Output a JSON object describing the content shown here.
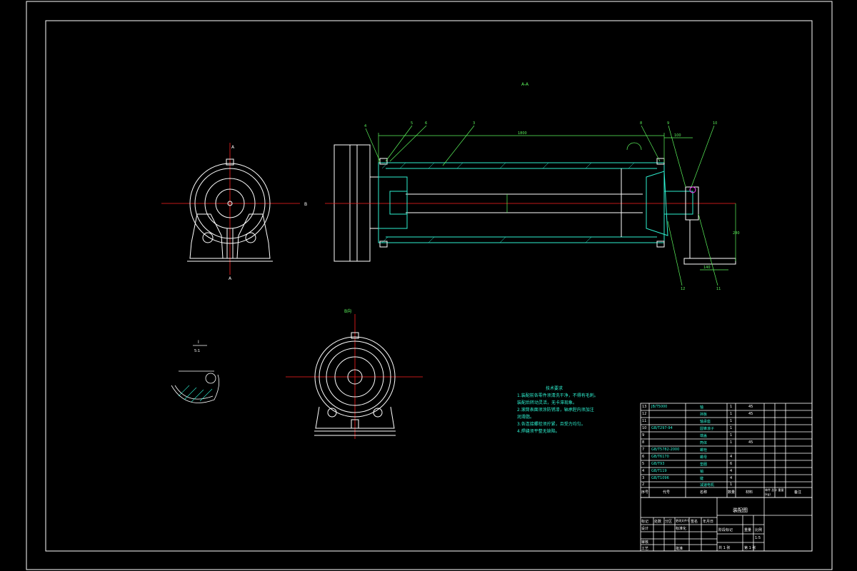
{
  "drawing": {
    "section_label": "A-A",
    "view_label_b": "B向",
    "detail_label": "I",
    "detail_scale": "5:1",
    "tech_notes_title": "技术要求",
    "tech_notes": [
      "1.装配前各零件须清洗干净，不得有毛刺。",
      "  装配后转动灵活，无卡滞现象。",
      "2.滚筒表面须涂防锈漆，轴承腔内须加注",
      "  润滑脂。",
      "3.各连接螺栓须拧紧，且受力均匀。",
      "4.焊缝须平整无缺陷。"
    ]
  },
  "title_block": {
    "drawing_name": "装配图",
    "company": "",
    "header_labels": {
      "index": "序号",
      "code": "代号",
      "name": "名称",
      "qty": "数量",
      "material": "材料",
      "weight": "单件 总计 重量(kg)",
      "remark": "备注"
    },
    "rows": [
      {
        "no": "13",
        "code": "JB/T5000",
        "name": "轴",
        "qty": "1",
        "mat": "45"
      },
      {
        "no": "12",
        "code": "",
        "name": "挡板",
        "qty": "1",
        "mat": "45"
      },
      {
        "no": "11",
        "code": "",
        "name": "轴承座",
        "qty": "1",
        "mat": ""
      },
      {
        "no": "10",
        "code": "GB/T297-94",
        "name": "圆锥滚子",
        "qty": "1",
        "mat": ""
      },
      {
        "no": "9",
        "code": "",
        "name": "端盖",
        "qty": "1",
        "mat": ""
      },
      {
        "no": "8",
        "code": "",
        "name": "筒体",
        "qty": "1",
        "mat": "45"
      },
      {
        "no": "7",
        "code": "GB/T5782-2000",
        "name": "螺栓",
        "qty": "",
        "mat": ""
      },
      {
        "no": "6",
        "code": "GB/T6170",
        "name": "螺母",
        "qty": "4",
        "mat": ""
      },
      {
        "no": "5",
        "code": "GB/T93",
        "name": "垫圈",
        "qty": "6",
        "mat": ""
      },
      {
        "no": "4",
        "code": "GB/T119",
        "name": "销",
        "qty": "4",
        "mat": ""
      },
      {
        "no": "3",
        "code": "GB/T1096",
        "name": "键",
        "qty": "4",
        "mat": ""
      },
      {
        "no": "2",
        "code": "",
        "name": "减速电机",
        "qty": "1",
        "mat": ""
      }
    ],
    "bottom_labels": [
      "标记",
      "处数",
      "分区",
      "更改文件号",
      "签名",
      "年月日"
    ],
    "design": "设计",
    "check": "审核",
    "process": "工艺",
    "standard": "标准化",
    "approve": "批准",
    "stage": "阶段标记",
    "weight": "重量",
    "scale": "比例",
    "scale_value": "1:5",
    "sheet_total": "共 1 张",
    "sheet_no": "第 1 张"
  },
  "dims": {
    "overall_length": "1800",
    "flange_width": "100",
    "height": "280",
    "base_width": "140"
  },
  "colors": {
    "frame": "#ffffff",
    "part": "#ffffff",
    "section": "#2ef0d0",
    "centerline": "#ff2020",
    "leader": "#5cf55c",
    "hatch": "#2ef0d0"
  }
}
